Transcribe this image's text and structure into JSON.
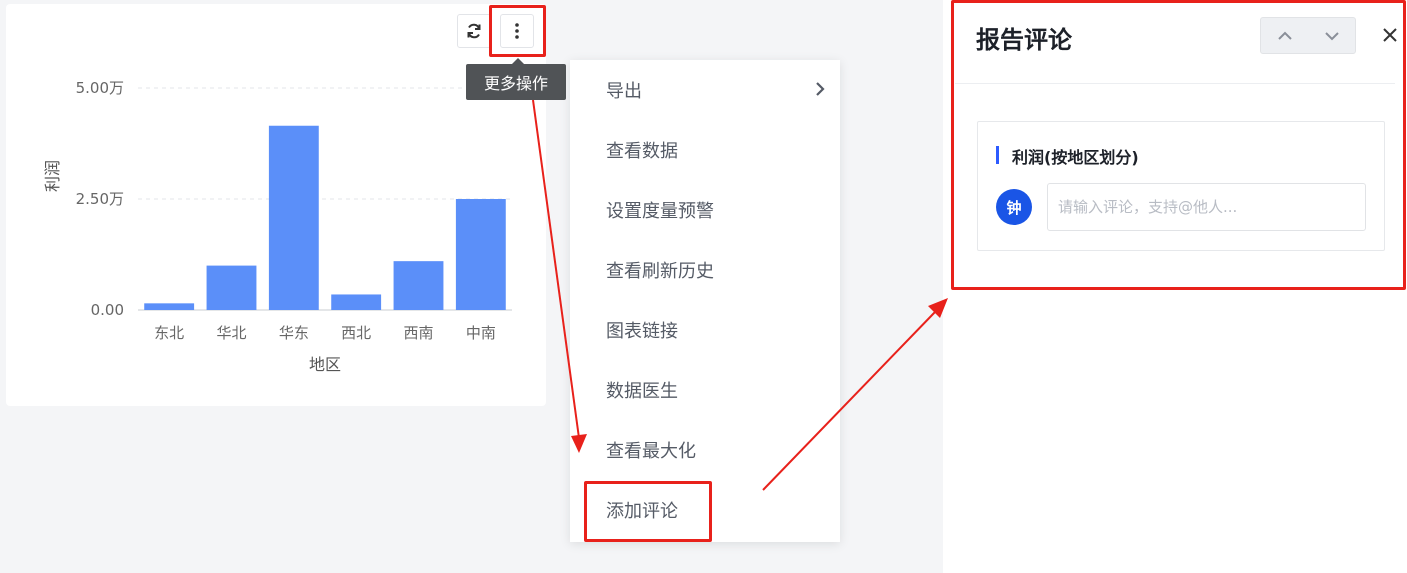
{
  "toolbar": {
    "refresh_icon": "refresh-icon",
    "more_icon": "more-vertical-icon",
    "more_tooltip": "更多操作"
  },
  "chart_data": {
    "type": "bar",
    "categories": [
      "东北",
      "华北",
      "华东",
      "西北",
      "西南",
      "中南"
    ],
    "values": [
      1500,
      10000,
      41500,
      3500,
      11000,
      25000
    ],
    "ylabel": "利润",
    "xlabel": "地区",
    "ylim": [
      0,
      50000
    ],
    "yticks": [
      {
        "value": 0,
        "label": "0.00"
      },
      {
        "value": 25000,
        "label": "2.50万"
      },
      {
        "value": 50000,
        "label": "5.00万"
      }
    ],
    "bar_color": "#5b8ff9",
    "grid": true
  },
  "menu": {
    "items": [
      {
        "label": "导出",
        "has_submenu": true
      },
      {
        "label": "查看数据"
      },
      {
        "label": "设置度量预警"
      },
      {
        "label": "查看刷新历史"
      },
      {
        "label": "图表链接"
      },
      {
        "label": "数据医生"
      },
      {
        "label": "查看最大化"
      },
      {
        "label": "添加评论"
      }
    ]
  },
  "panel": {
    "title": "报告评论",
    "card_title": "利润(按地区划分)",
    "avatar_text": "钟",
    "input_placeholder": "请输入评论，支持@他人..."
  },
  "colors": {
    "highlight": "#e8211b",
    "accent": "#1a55e6",
    "bar": "#5b8ff9"
  }
}
